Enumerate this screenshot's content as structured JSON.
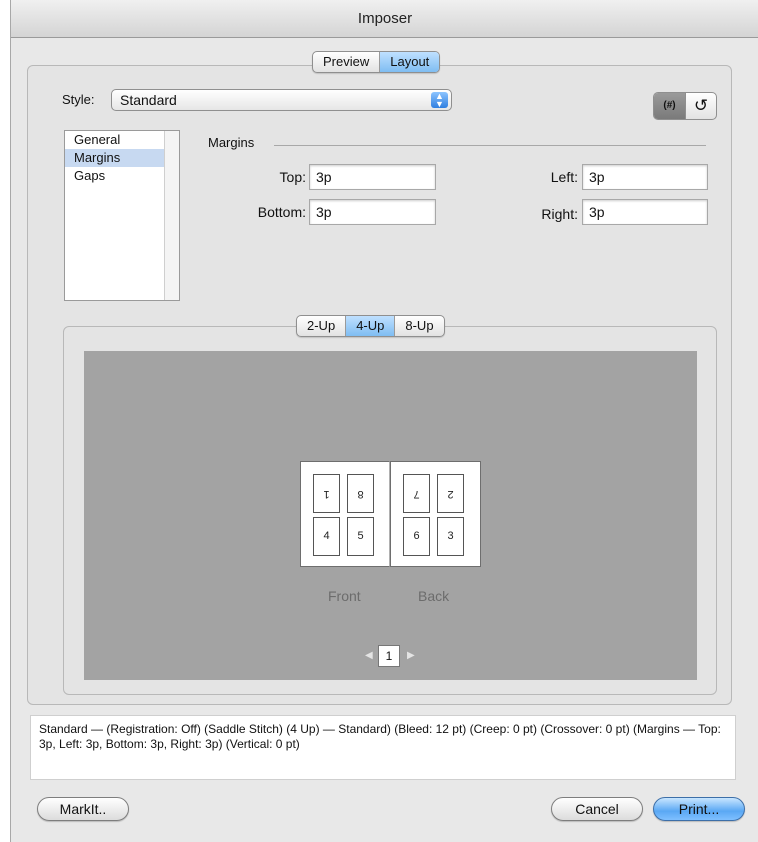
{
  "window": {
    "title": "Imposer"
  },
  "top_tabs": [
    {
      "label": "Preview",
      "selected": false
    },
    {
      "label": "Layout",
      "selected": true
    }
  ],
  "style": {
    "label": "Style:",
    "value": "Standard"
  },
  "icons": {
    "numbering_toggle": "(#)",
    "reset": "↺"
  },
  "sections": [
    {
      "label": "General",
      "selected": false
    },
    {
      "label": "Margins",
      "selected": true
    },
    {
      "label": "Gaps",
      "selected": false
    }
  ],
  "margins": {
    "title": "Margins",
    "top_label": "Top:",
    "top_value": "3p",
    "bottom_label": "Bottom:",
    "bottom_value": "3p",
    "left_label": "Left:",
    "left_value": "3p",
    "right_label": "Right:",
    "right_value": "3p"
  },
  "up_tabs": [
    {
      "label": "2-Up",
      "selected": false
    },
    {
      "label": "4-Up",
      "selected": true
    },
    {
      "label": "8-Up",
      "selected": false
    }
  ],
  "preview": {
    "front_label": "Front",
    "back_label": "Back",
    "front_pages": [
      "1",
      "8",
      "4",
      "5"
    ],
    "back_pages": [
      "7",
      "2",
      "6",
      "3"
    ],
    "page_number": "1"
  },
  "summary": "Standard — (Registration: Off) (Saddle Stitch) (4 Up) — Standard) (Bleed: 12 pt) (Creep: 0 pt) (Crossover: 0 pt) (Margins — Top: 3p, Left: 3p, Bottom: 3p, Right: 3p) (Vertical: 0 pt)",
  "buttons": {
    "markit": "MarkIt..",
    "cancel": "Cancel",
    "print": "Print..."
  }
}
